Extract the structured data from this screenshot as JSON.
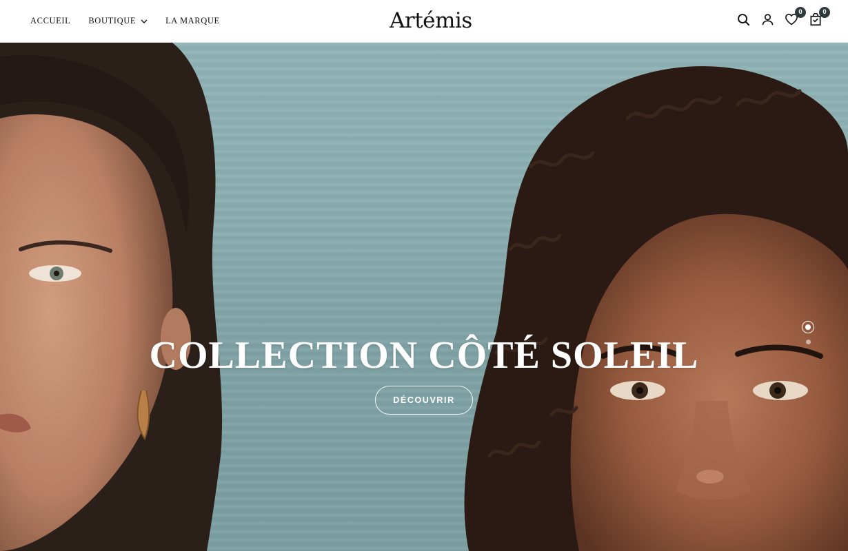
{
  "header": {
    "nav": [
      {
        "label": "ACCUEIL"
      },
      {
        "label": "BOUTIQUE",
        "has_dropdown": true
      },
      {
        "label": "LA MARQUE"
      }
    ],
    "logo": "Artémis",
    "icons": [
      "search-icon",
      "account-icon",
      "wishlist-icon",
      "cart-icon"
    ],
    "wishlist_count": "0",
    "cart_count": "0",
    "badge_color": "#2f3a3a"
  },
  "hero": {
    "title": "COLLECTION CÔTÉ SOLEIL",
    "cta_label": "DÉCOUVRIR",
    "slides_total": 2,
    "active_slide": 1
  }
}
